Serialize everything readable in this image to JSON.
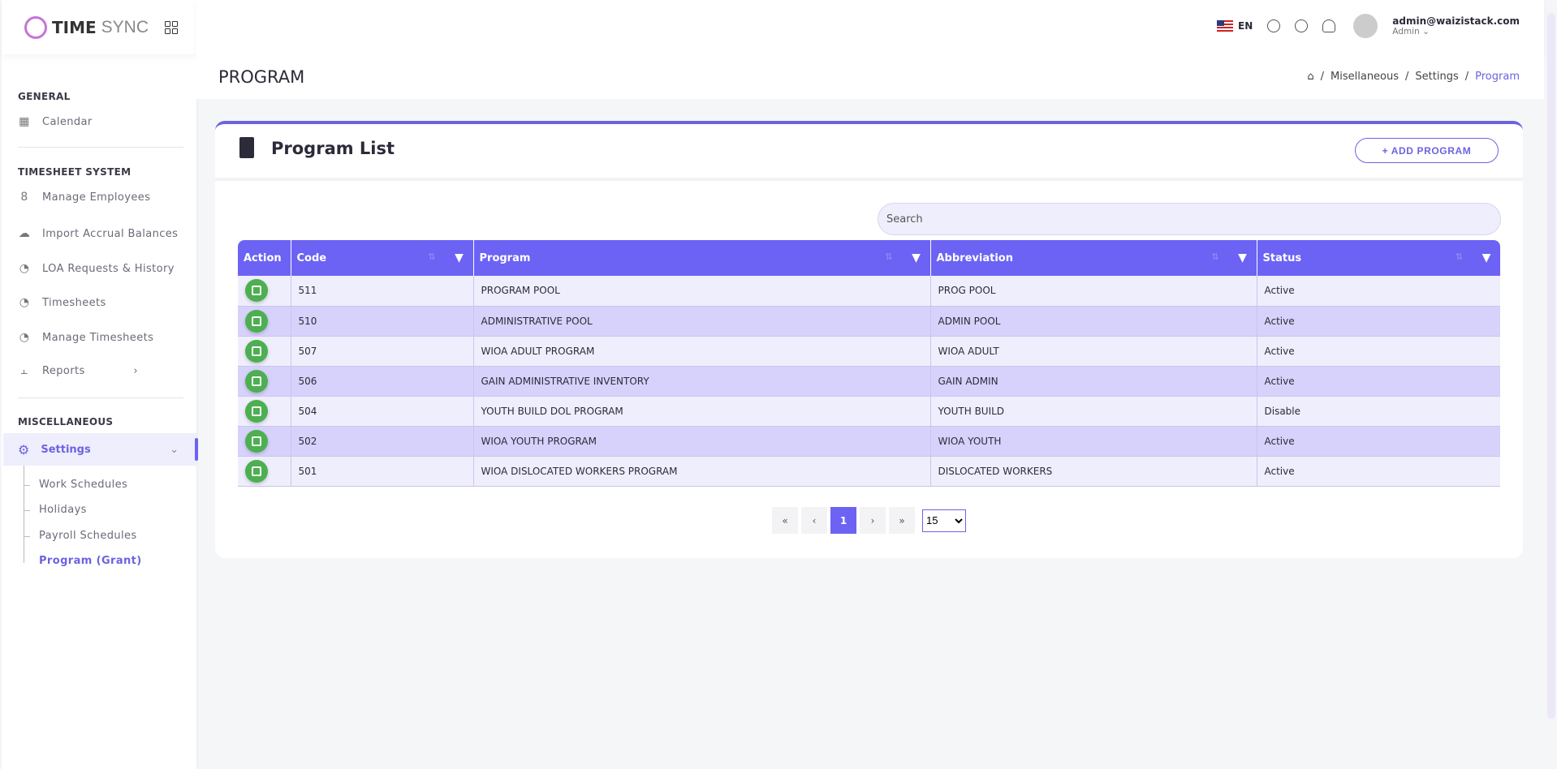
{
  "app": {
    "logo_bold": "TIME",
    "logo_light": "SYNC"
  },
  "header": {
    "lang": "EN",
    "email": "admin@waizistack.com",
    "role": "Admin ⌄"
  },
  "page": {
    "title": "PROGRAM",
    "breadcrumb": [
      "Misellaneous",
      "Settings",
      "Program"
    ]
  },
  "sidebar": {
    "general": "GENERAL",
    "calendar": "Calendar",
    "timesheet": "TIMESHEET SYSTEM",
    "items": [
      {
        "label": "Manage Employees",
        "icon": "users-icon"
      },
      {
        "label": "Import Accrual Balances",
        "icon": "cloud-upload-icon"
      },
      {
        "label": "LOA Requests & History",
        "icon": "clock-icon"
      },
      {
        "label": "Timesheets",
        "icon": "clock-icon"
      },
      {
        "label": "Manage Timesheets",
        "icon": "clock-icon"
      },
      {
        "label": "Reports",
        "icon": "chart-icon"
      }
    ],
    "misc": "MISCELLANEOUS",
    "settings": "Settings",
    "sub": [
      "Work Schedules",
      "Holidays",
      "Payroll Schedules",
      "Program (Grant)"
    ]
  },
  "card": {
    "title": "Program List",
    "add_label": "+ ADD PROGRAM",
    "search_placeholder": "Search"
  },
  "table": {
    "headers": [
      "Action",
      "Code",
      "Program",
      "Abbreviation",
      "Status"
    ],
    "rows": [
      [
        "511",
        "PROGRAM POOL",
        "PROG POOL",
        "Active"
      ],
      [
        "510",
        "ADMINISTRATIVE POOL",
        "ADMIN POOL",
        "Active"
      ],
      [
        "507",
        "WIOA ADULT PROGRAM",
        "WIOA ADULT",
        "Active"
      ],
      [
        "506",
        "GAIN ADMINISTRATIVE INVENTORY",
        "GAIN ADMIN",
        "Active"
      ],
      [
        "504",
        "YOUTH BUILD DOL PROGRAM",
        "YOUTH BUILD",
        "Disable"
      ],
      [
        "502",
        "WIOA YOUTH PROGRAM",
        "WIOA YOUTH",
        "Active"
      ],
      [
        "501",
        "WIOA DISLOCATED WORKERS PROGRAM",
        "DISLOCATED WORKERS",
        "Active"
      ]
    ]
  },
  "pager": {
    "first": "«",
    "prev": "‹",
    "page": "1",
    "next": "›",
    "last": "»",
    "page_size": "15"
  },
  "colors": {
    "accent": "#6c63f4",
    "edit": "#4caf50"
  }
}
